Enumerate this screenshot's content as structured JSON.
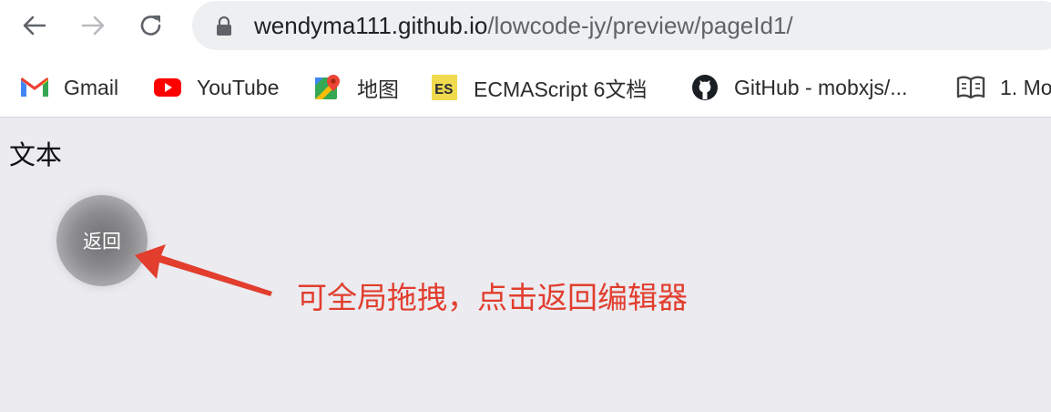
{
  "browser": {
    "url_host": "wendyma111.github.io",
    "url_path": "/lowcode-jy/preview/pageId1/",
    "icons": {
      "back": "arrow-left-icon",
      "forward": "arrow-right-icon",
      "reload": "reload-icon",
      "lock": "lock-icon"
    }
  },
  "bookmarks": [
    {
      "label": "Gmail",
      "icon": "gmail-icon"
    },
    {
      "label": "YouTube",
      "icon": "youtube-icon"
    },
    {
      "label": "地图",
      "icon": "maps-icon"
    },
    {
      "label": "ECMAScript 6文档",
      "icon": "es-icon"
    },
    {
      "label": "GitHub - mobxjs/...",
      "icon": "github-icon"
    },
    {
      "label": "1. Mo",
      "icon": "book-icon"
    }
  ],
  "page": {
    "text": "文本",
    "back_button_label": "返回",
    "annotation": "可全局拖拽，点击返回编辑器"
  },
  "colors": {
    "page_bg": "#ebebf0",
    "annotation": "#e23d2d",
    "es_badge": "#f0db4f",
    "youtube_red": "#ff0000"
  }
}
